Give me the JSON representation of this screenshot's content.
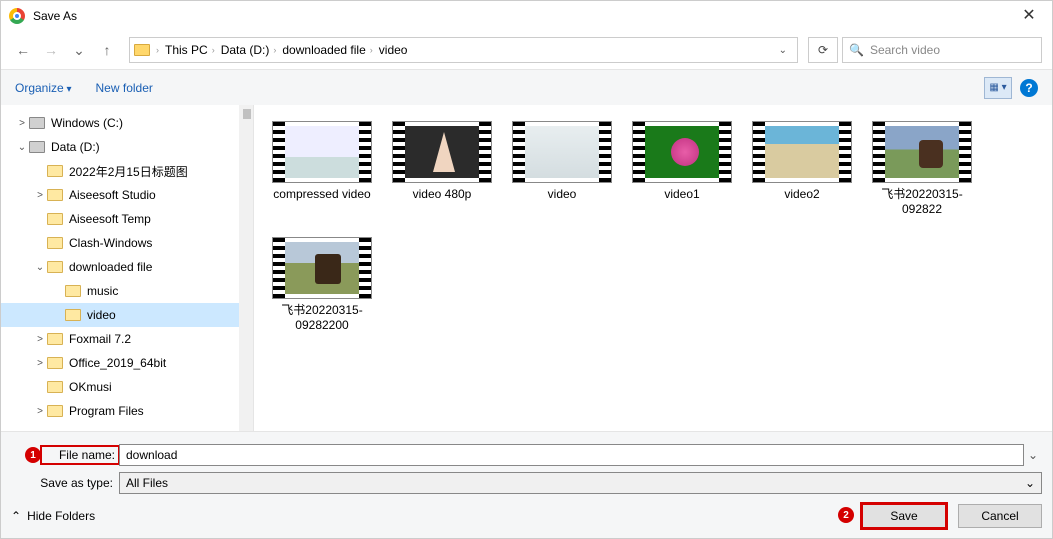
{
  "window": {
    "title": "Save As",
    "close_glyph": "✕"
  },
  "nav": {
    "back_glyph": "←",
    "forward_glyph": "→",
    "recent_glyph": "⌄",
    "up_glyph": "↑",
    "refresh_glyph": "⟳"
  },
  "breadcrumb": {
    "items": [
      "This PC",
      "Data (D:)",
      "downloaded file",
      "video"
    ],
    "sep": "›"
  },
  "search": {
    "placeholder": "Search video",
    "mag_glyph": "🔍"
  },
  "toolbar": {
    "organize": "Organize",
    "new_folder": "New folder",
    "view_glyph": "▦ ▾",
    "help_glyph": "?"
  },
  "tree": [
    {
      "indent": "A",
      "chev": ">",
      "icon": "drive",
      "label": "Windows (C:)"
    },
    {
      "indent": "A",
      "chev": "⌄",
      "icon": "drive",
      "label": "Data (D:)"
    },
    {
      "indent": "B",
      "chev": "",
      "icon": "folder",
      "label": "2022年2月15日标题图"
    },
    {
      "indent": "B",
      "chev": ">",
      "icon": "folder",
      "label": "Aiseesoft Studio"
    },
    {
      "indent": "B",
      "chev": "",
      "icon": "folder",
      "label": "Aiseesoft Temp"
    },
    {
      "indent": "B",
      "chev": "",
      "icon": "folder",
      "label": "Clash-Windows"
    },
    {
      "indent": "B",
      "chev": "⌄",
      "icon": "folder",
      "label": "downloaded file"
    },
    {
      "indent": "C",
      "chev": "",
      "icon": "folder",
      "label": "music"
    },
    {
      "indent": "C",
      "chev": "",
      "icon": "folder",
      "label": "video",
      "selected": true
    },
    {
      "indent": "B",
      "chev": ">",
      "icon": "folder",
      "label": "Foxmail 7.2"
    },
    {
      "indent": "B",
      "chev": ">",
      "icon": "folder",
      "label": "Office_2019_64bit"
    },
    {
      "indent": "B",
      "chev": "",
      "icon": "folder",
      "label": "OKmusi"
    },
    {
      "indent": "B",
      "chev": ">",
      "icon": "folder",
      "label": "Program Files"
    }
  ],
  "files": [
    {
      "thumb": "thumb1",
      "label": "compressed video"
    },
    {
      "thumb": "thumb2",
      "label": "video 480p"
    },
    {
      "thumb": "thumb3",
      "label": "video"
    },
    {
      "thumb": "thumb4",
      "label": "video1"
    },
    {
      "thumb": "thumb5",
      "label": "video2"
    },
    {
      "thumb": "thumb6",
      "label": "飞书20220315-092822"
    },
    {
      "thumb": "thumb7",
      "label": "飞书20220315-09282200"
    }
  ],
  "form": {
    "file_name_label": "File name:",
    "file_name_value": "download",
    "save_type_label": "Save as type:",
    "save_type_value": "All Files",
    "dropdown_glyph": "⌄"
  },
  "buttons": {
    "hide_folders": "Hide Folders",
    "hide_chevron": "⌃",
    "save": "Save",
    "cancel": "Cancel"
  },
  "annotations": {
    "badge1": "1",
    "badge2": "2"
  }
}
